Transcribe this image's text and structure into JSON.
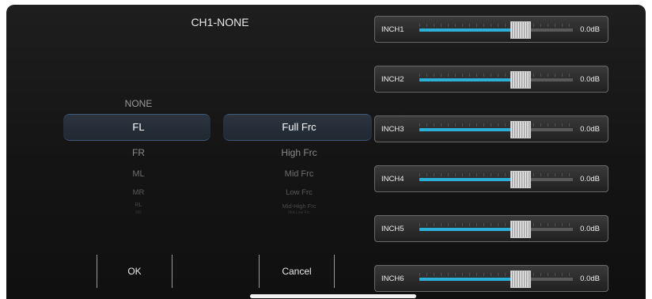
{
  "title": "CH1-NONE",
  "left_picker": {
    "items": [
      "NONE",
      "FL",
      "FR",
      "ML",
      "MR",
      "RL",
      "RR"
    ],
    "selected": "FL"
  },
  "right_picker": {
    "items": [
      "Full Frc",
      "High Frc",
      "Mid Frc",
      "Low Frc",
      "Mid-High Frc",
      "Mid-Low Frc"
    ],
    "selected": "Full Frc"
  },
  "buttons": {
    "ok": "OK",
    "cancel": "Cancel"
  },
  "channels": [
    {
      "name": "INCH1",
      "value": "0.0dB",
      "level": 0.66
    },
    {
      "name": "INCH2",
      "value": "0.0dB",
      "level": 0.66
    },
    {
      "name": "INCH3",
      "value": "0.0dB",
      "level": 0.66
    },
    {
      "name": "INCH4",
      "value": "0.0dB",
      "level": 0.66
    },
    {
      "name": "INCH5",
      "value": "0.0dB",
      "level": 0.66
    },
    {
      "name": "INCH6",
      "value": "0.0dB",
      "level": 0.66
    }
  ],
  "colors": {
    "accent": "#2cb0d8",
    "background": "#161616",
    "text": "#e8e8e8"
  }
}
